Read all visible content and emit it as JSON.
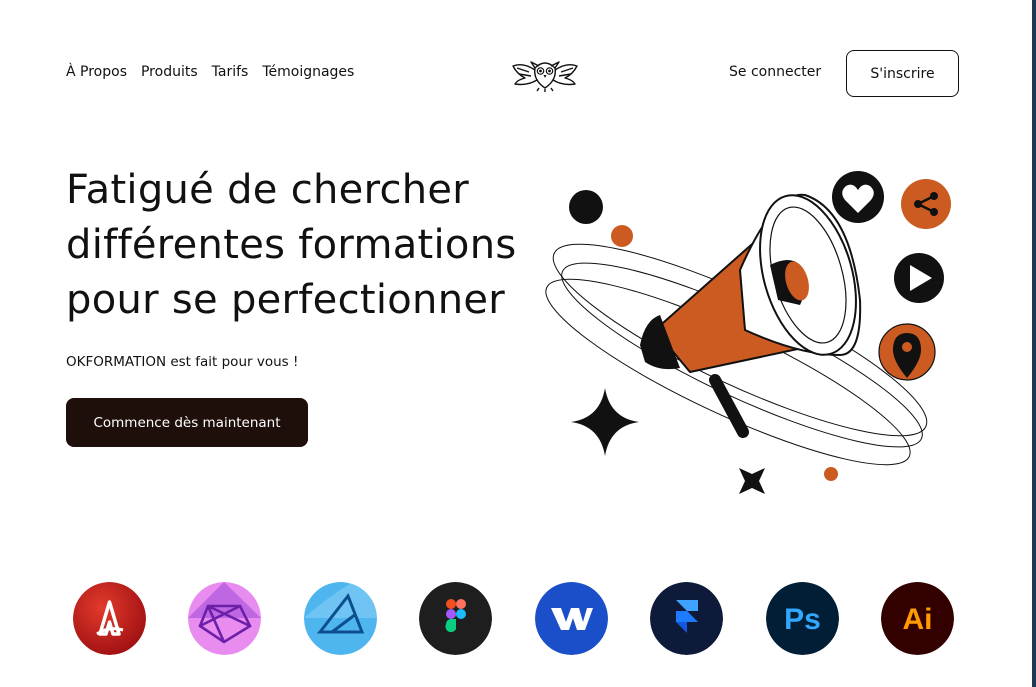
{
  "nav": {
    "items": [
      "À Propos",
      "Produits",
      "Tarifs",
      "Témoignages"
    ],
    "login_label": "Se connecter",
    "signup_label": "S'inscrire"
  },
  "brand": {
    "logo_icon": "owl-logo-icon"
  },
  "hero": {
    "title_lines": [
      "Fatigué de chercher",
      "différentes formations",
      "pour se perfectionner"
    ],
    "subtitle": "OKFORMATION est fait pour vous !",
    "cta_label": "Commence dès maintenant",
    "illustration_icons": [
      "megaphone-icon",
      "heart-icon",
      "share-icon",
      "play-icon",
      "location-pin-icon",
      "sparkle-icon"
    ]
  },
  "tools": {
    "icons": [
      "adobe-express-icon",
      "affinity-photo-icon",
      "affinity-designer-icon",
      "figma-icon",
      "webflow-icon",
      "framer-icon",
      "photoshop-icon",
      "illustrator-icon"
    ],
    "labels": {
      "photoshop": "Ps",
      "illustrator": "Ai"
    }
  },
  "colors": {
    "accent": "#cc5b22",
    "dark": "#1e0f0a",
    "text": "#111111",
    "background": "#ffffff"
  }
}
